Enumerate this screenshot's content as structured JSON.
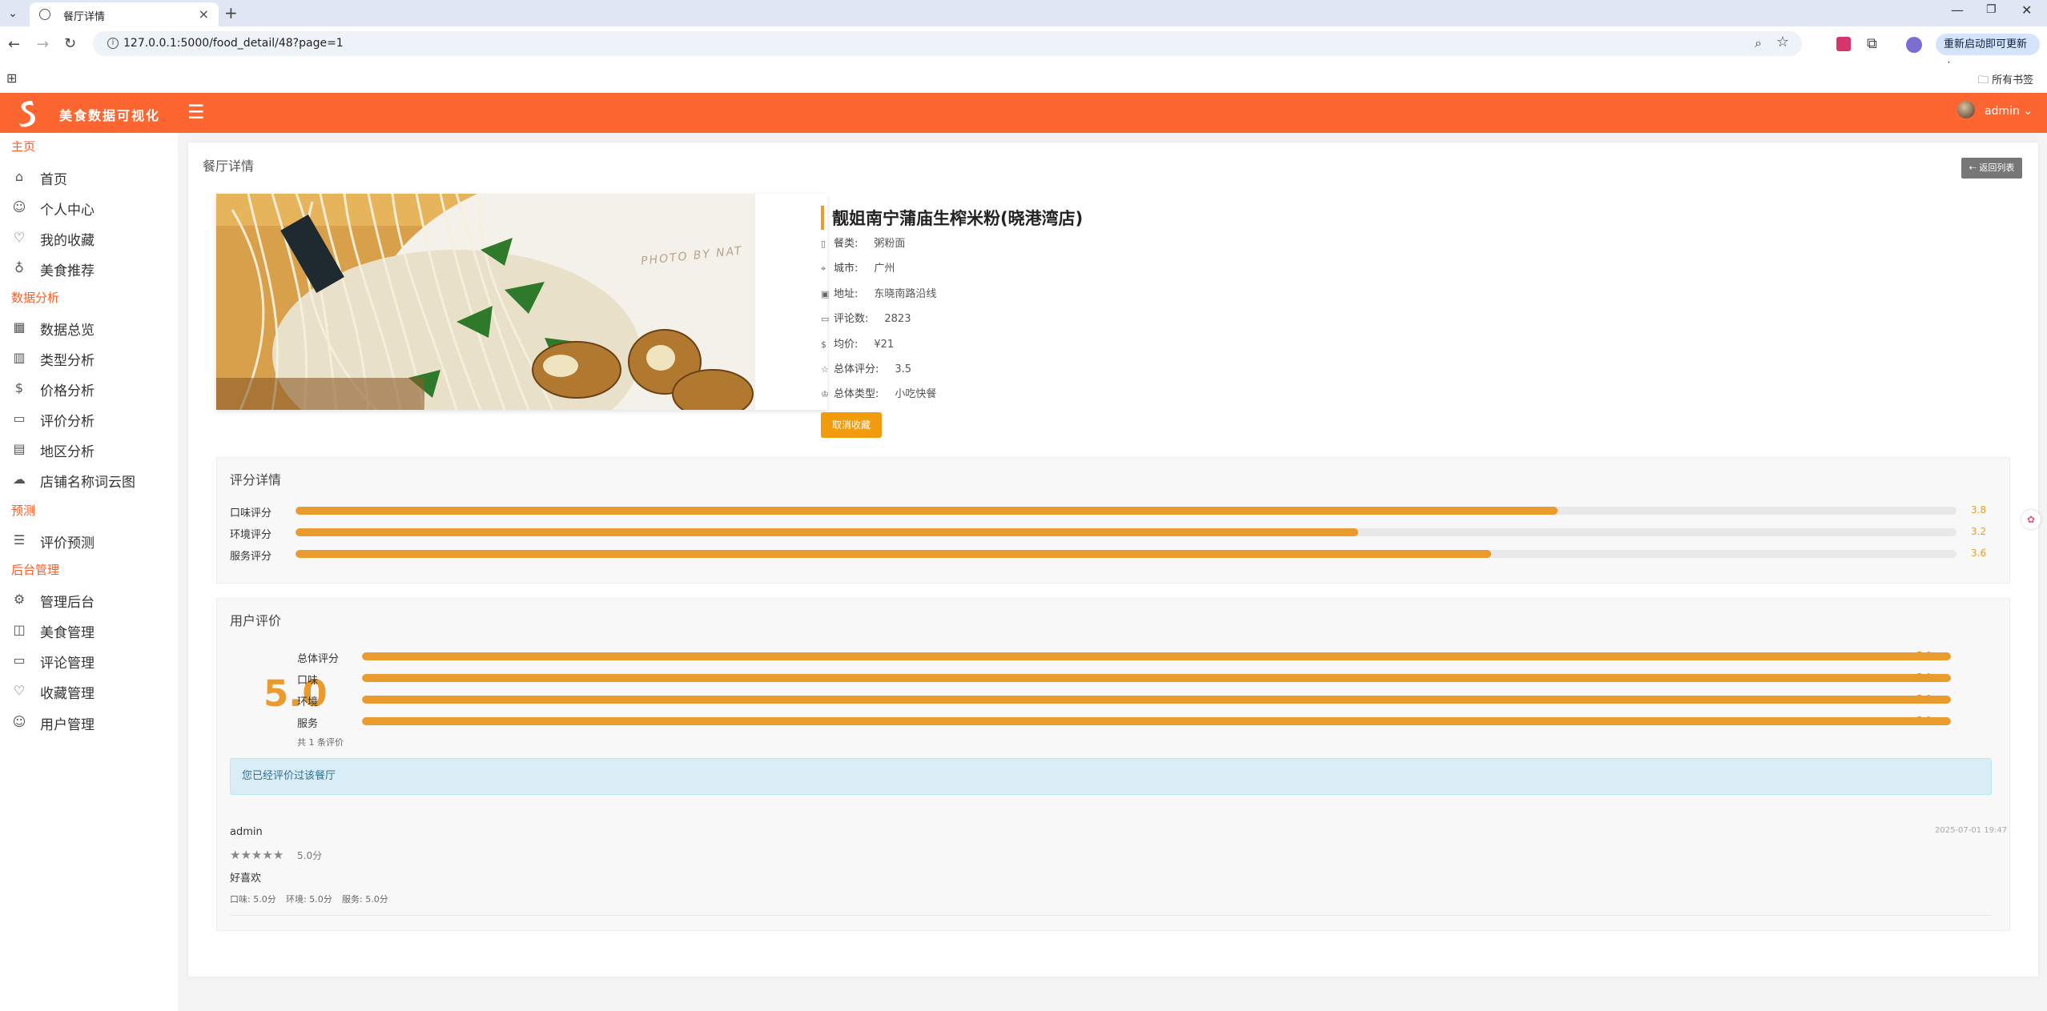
{
  "browser": {
    "tab_title": "餐厅详情",
    "url": "127.0.0.1:5000/food_detail/48?page=1",
    "update_label": "重新启动即可更新",
    "bookmarks_label": "所有书签",
    "icons": [
      "tab-list-icon",
      "globe-icon",
      "close-icon",
      "new-tab-icon",
      "back-icon",
      "forward-icon",
      "reload-icon",
      "site-info-icon",
      "zoom-icon",
      "bookmark-star-icon",
      "extension-icon",
      "puzzle-icon",
      "profile-icon",
      "apps-icon",
      "folder-icon"
    ]
  },
  "header": {
    "brand": "美食数据可视化",
    "user": "admin",
    "accent_color": "#fd6631"
  },
  "sidebar": {
    "groups": [
      {
        "title": "主页",
        "items": [
          {
            "label": "首页",
            "icon": "home-icon"
          },
          {
            "label": "个人中心",
            "icon": "user-icon"
          },
          {
            "label": "我的收藏",
            "icon": "heart-icon"
          },
          {
            "label": "美食推荐",
            "icon": "lightbulb-icon"
          }
        ]
      },
      {
        "title": "数据分析",
        "items": [
          {
            "label": "数据总览",
            "icon": "layout-icon"
          },
          {
            "label": "类型分析",
            "icon": "chart-icon"
          },
          {
            "label": "价格分析",
            "icon": "dollar-icon"
          },
          {
            "label": "评价分析",
            "icon": "comment-icon"
          },
          {
            "label": "地区分析",
            "icon": "map-icon"
          },
          {
            "label": "店铺名称词云图",
            "icon": "cloud-icon"
          }
        ]
      },
      {
        "title": "预测",
        "items": [
          {
            "label": "评价预测",
            "icon": "list-icon"
          }
        ]
      },
      {
        "title": "后台管理",
        "items": [
          {
            "label": "管理后台",
            "icon": "gear-icon"
          },
          {
            "label": "美食管理",
            "icon": "box-icon"
          },
          {
            "label": "评论管理",
            "icon": "message-icon"
          },
          {
            "label": "收藏管理",
            "icon": "heart-handshake-icon"
          },
          {
            "label": "用户管理",
            "icon": "user-icon"
          }
        ]
      }
    ]
  },
  "page": {
    "title": "餐厅详情",
    "back_label": "返回列表",
    "photo_watermark": "PHOTO BY NAT",
    "restaurant": {
      "name": "靓姐南宁蒲庙生榨米粉(晓港湾店)",
      "fields": [
        {
          "key": "餐类:",
          "value": "粥粉面",
          "icon": "utensils-icon"
        },
        {
          "key": "城市:",
          "value": "广州",
          "icon": "location-icon"
        },
        {
          "key": "地址:",
          "value": "东晓南路沿线",
          "icon": "building-icon"
        },
        {
          "key": "评论数:",
          "value": "2823",
          "icon": "comment-icon"
        },
        {
          "key": "均价:",
          "value": "¥21",
          "icon": "dollar-icon"
        },
        {
          "key": "总体评分:",
          "value": "3.5",
          "icon": "star-icon"
        },
        {
          "key": "总体类型:",
          "value": "小吃快餐",
          "icon": "crown-icon"
        }
      ],
      "unfavorite_label": "取消收藏"
    },
    "rating_details": {
      "title": "评分详情",
      "max": 5,
      "rows": [
        {
          "label": "口味评分",
          "value": 3.8,
          "text": "3.8"
        },
        {
          "label": "环境评分",
          "value": 3.2,
          "text": "3.2"
        },
        {
          "label": "服务评分",
          "value": 3.6,
          "text": "3.6"
        }
      ]
    },
    "user_reviews": {
      "title": "用户评价",
      "average": "5.0",
      "max": 5,
      "rows": [
        {
          "label": "总体评分",
          "value": 5.0,
          "text": "5.0"
        },
        {
          "label": "口味",
          "value": 5.0,
          "text": "5.0"
        },
        {
          "label": "环境",
          "value": 5.0,
          "text": "5.0"
        },
        {
          "label": "服务",
          "value": 5.0,
          "text": "5.0"
        }
      ],
      "count_note": "共 1 条评价",
      "alert": "您已经评价过该餐厅",
      "comment": {
        "user": "admin",
        "time": "2025-07-01 19:47",
        "stars": "★★★★★",
        "score": "5.0分",
        "text": "好喜欢",
        "sub_scores": [
          "口味: 5.0分",
          "环境: 5.0分",
          "服务: 5.0分"
        ]
      }
    }
  }
}
